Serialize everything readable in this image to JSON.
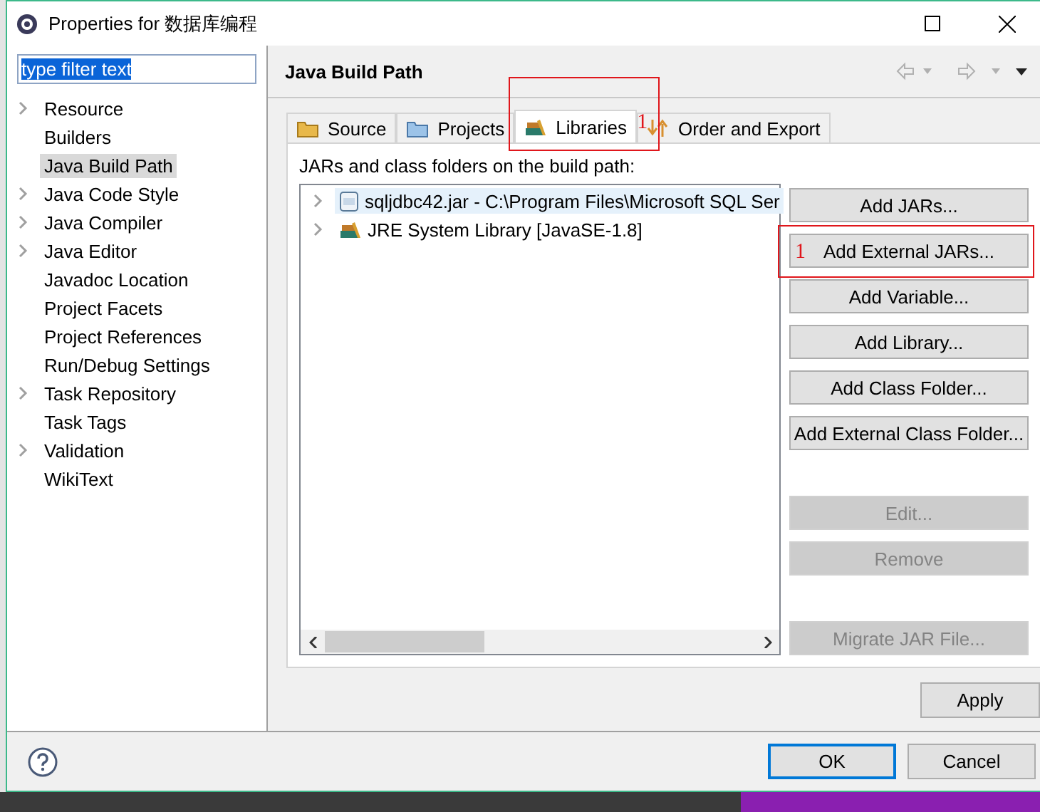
{
  "window": {
    "title": "Properties for 数据库编程"
  },
  "filter": {
    "value": "type filter text",
    "selected": true
  },
  "sidebar": {
    "items": [
      {
        "label": "Resource",
        "expandable": true,
        "selected": false
      },
      {
        "label": "Builders",
        "expandable": false,
        "selected": false
      },
      {
        "label": "Java Build Path",
        "expandable": false,
        "selected": true
      },
      {
        "label": "Java Code Style",
        "expandable": true,
        "selected": false
      },
      {
        "label": "Java Compiler",
        "expandable": true,
        "selected": false
      },
      {
        "label": "Java Editor",
        "expandable": true,
        "selected": false
      },
      {
        "label": "Javadoc Location",
        "expandable": false,
        "selected": false
      },
      {
        "label": "Project Facets",
        "expandable": false,
        "selected": false
      },
      {
        "label": "Project References",
        "expandable": false,
        "selected": false
      },
      {
        "label": "Run/Debug Settings",
        "expandable": false,
        "selected": false
      },
      {
        "label": "Task Repository",
        "expandable": true,
        "selected": false
      },
      {
        "label": "Task Tags",
        "expandable": false,
        "selected": false
      },
      {
        "label": "Validation",
        "expandable": true,
        "selected": false
      },
      {
        "label": "WikiText",
        "expandable": false,
        "selected": false
      }
    ]
  },
  "page": {
    "title": "Java Build Path"
  },
  "tabs": [
    {
      "kind": "source",
      "label": "Source",
      "selected": false
    },
    {
      "kind": "projects",
      "label": "Projects",
      "selected": false
    },
    {
      "kind": "libraries",
      "label": "Libraries",
      "selected": true,
      "annotation": "1"
    },
    {
      "kind": "order",
      "label": "Order and Export",
      "selected": false
    }
  ],
  "libraries": {
    "caption": "JARs and class folders on the build path:",
    "entries": [
      {
        "kind": "jar",
        "label": "sqljdbc42.jar - C:\\Program Files\\Microsoft SQL Ser",
        "selected": true
      },
      {
        "kind": "jre",
        "label": "JRE System Library [JavaSE-1.8]",
        "selected": false
      }
    ]
  },
  "buttons": [
    {
      "label": "Add JARs...",
      "disabled": false
    },
    {
      "label": "Add External JARs...",
      "disabled": false,
      "annotation": "1"
    },
    {
      "label": "Add Variable...",
      "disabled": false
    },
    {
      "label": "Add Library...",
      "disabled": false
    },
    {
      "label": "Add Class Folder...",
      "disabled": false
    },
    {
      "label": "Add External Class Folder...",
      "disabled": false
    },
    {
      "label": "Edit...",
      "disabled": true
    },
    {
      "label": "Remove",
      "disabled": true
    },
    {
      "label": "Migrate JAR File...",
      "disabled": true
    }
  ],
  "apply": "Apply",
  "footer": {
    "ok": "OK",
    "cancel": "Cancel"
  }
}
